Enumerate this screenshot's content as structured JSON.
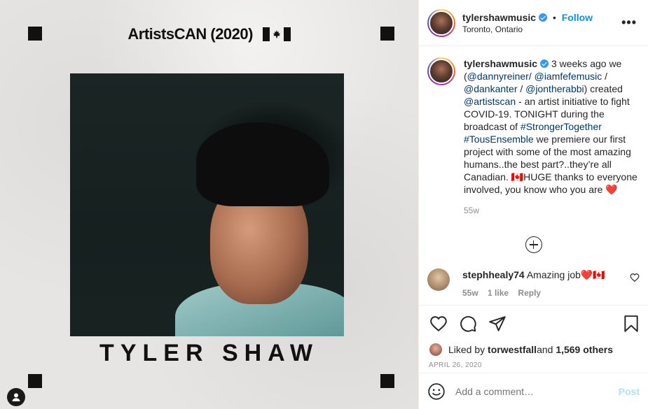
{
  "media": {
    "title": "ArtistsCAN (2020)",
    "flag_icon": "canada-flag-icon",
    "name": "TYLER SHAW",
    "user_tag_icon": "user-tag-icon"
  },
  "header": {
    "username": "tylershawmusic",
    "verified": true,
    "separator": "•",
    "follow_label": "Follow",
    "location": "Toronto, Ontario",
    "more_label": "•••"
  },
  "caption": {
    "username": "tylershawmusic",
    "segments": [
      {
        "t": " 3 weeks ago we ("
      },
      {
        "t": "@dannyreiner/",
        "link": true
      },
      {
        "t": " "
      },
      {
        "t": "@iamfefemusic",
        "link": true
      },
      {
        "t": " / "
      },
      {
        "t": "@dankanter",
        "link": true
      },
      {
        "t": " / "
      },
      {
        "t": "@jontherabbi",
        "link": true
      },
      {
        "t": ") created "
      },
      {
        "t": "@artistscan",
        "link": true
      },
      {
        "t": " - an artist initiative to fight COVID-19. TONIGHT during the broadcast of "
      },
      {
        "t": "#StrongerTogether",
        "link": true
      },
      {
        "t": " "
      },
      {
        "t": "#TousEnsemble",
        "link": true
      },
      {
        "t": " we premiere our first project with some of the most amazing humans..the best part?..they’re all Canadian. 🇨🇦HUGE thanks to everyone involved, you know who you are ❤️"
      }
    ],
    "age": "55w"
  },
  "comments": [
    {
      "username": "stephhealy74",
      "text": "Amazing job❤️🇨🇦",
      "age": "55w",
      "likes": "1 like",
      "reply": "Reply"
    }
  ],
  "actions": {
    "like_icon": "heart-icon",
    "comment_icon": "comment-icon",
    "share_icon": "share-icon",
    "save_icon": "bookmark-icon"
  },
  "likes": {
    "prefix": "Liked by ",
    "user": "torwestfall",
    "middle": " and ",
    "others": "1,569 others"
  },
  "date": "APRIL 26, 2020",
  "add_comment": {
    "placeholder": "Add a comment…",
    "post_label": "Post",
    "emoji_icon": "emoji-icon"
  },
  "colors": {
    "link": "#00376b",
    "follow": "#0095f6",
    "post_disabled": "#b2dffc",
    "verified": "#3897f0"
  }
}
